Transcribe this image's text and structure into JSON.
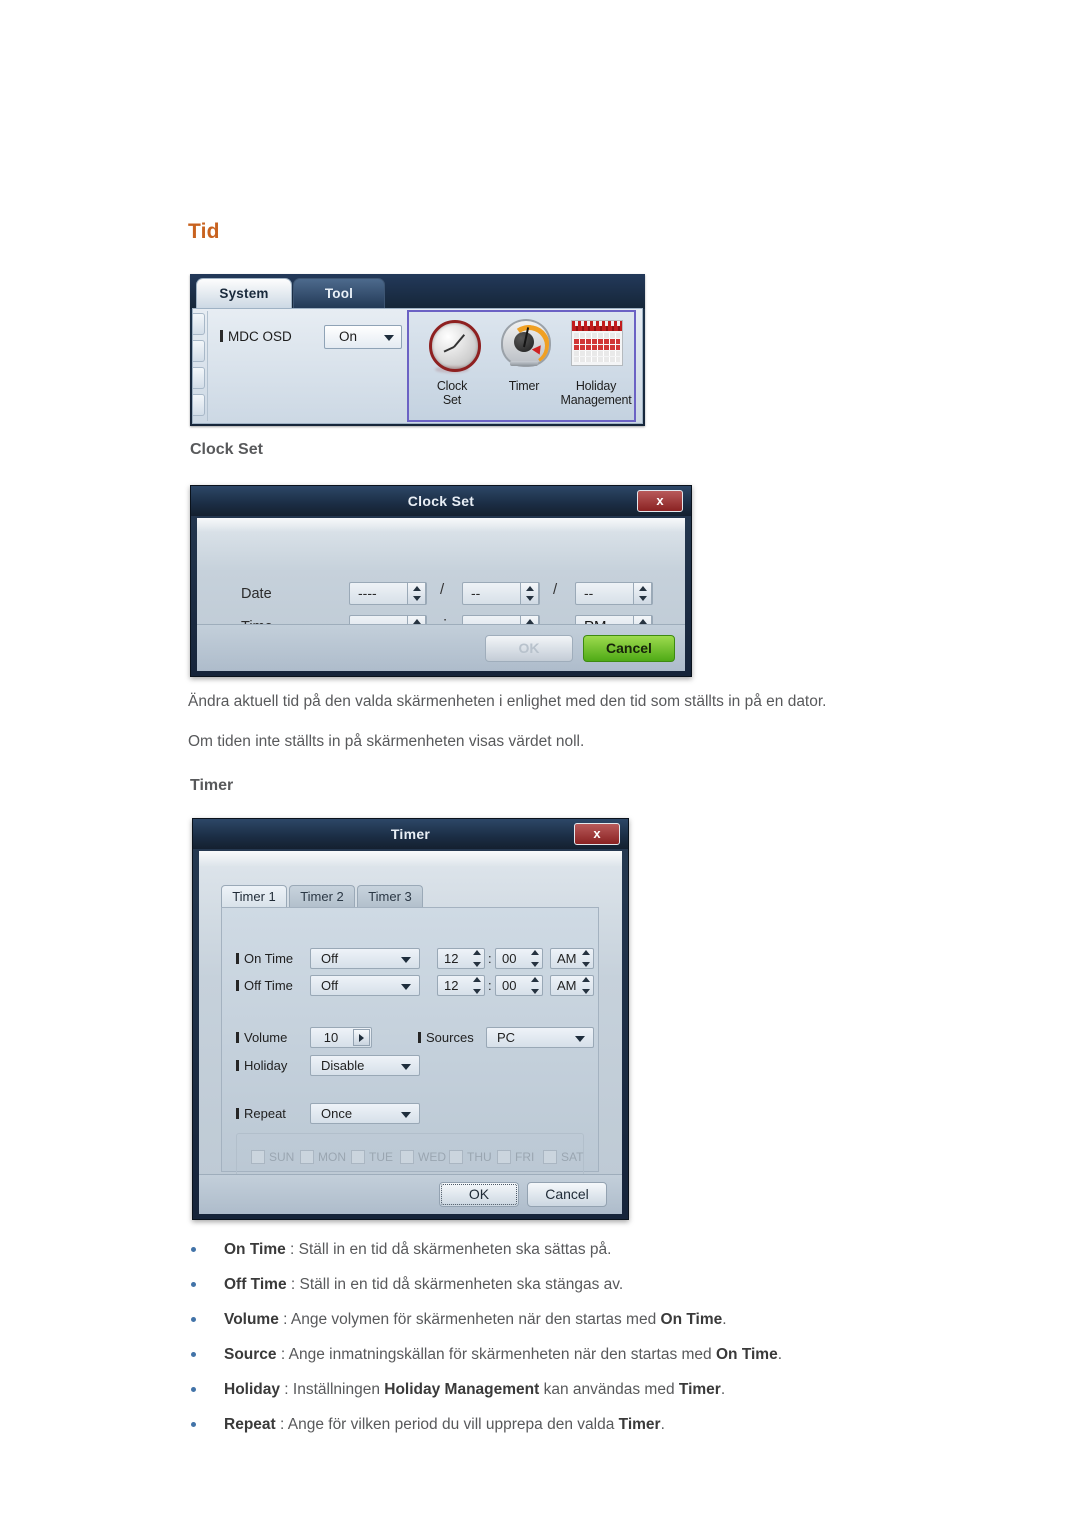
{
  "page": {
    "heading": "Tid",
    "subheadings": {
      "clock_set": "Clock Set",
      "timer": "Timer"
    },
    "paragraphs": {
      "p1": "Ändra aktuell tid på den valda skärmenheten i enlighet med den tid som ställts in på en dator.",
      "p2": "Om tiden inte ställts in på skärmenheten visas värdet noll."
    },
    "accent_color": "#c8621f",
    "text_color": "#58595b",
    "bullet_color": "#4273a8"
  },
  "mdc_panel": {
    "tabs": [
      {
        "label": "System",
        "active": true
      },
      {
        "label": "Tool",
        "active": false
      }
    ],
    "osd": {
      "label": "MDC OSD",
      "value": "On"
    },
    "icons": [
      {
        "name": "clock-set",
        "caption_line1": "Clock",
        "caption_line2": "Set"
      },
      {
        "name": "timer",
        "caption_line1": "Timer",
        "caption_line2": ""
      },
      {
        "name": "holiday-management",
        "caption_line1": "Holiday",
        "caption_line2": "Management"
      }
    ],
    "selection_color": "#6b62c4"
  },
  "clock_set_dialog": {
    "title": "Clock Set",
    "close_label": "x",
    "rows": [
      {
        "label": "Date",
        "fields": [
          {
            "value": "----"
          },
          {
            "value": "--"
          },
          {
            "value": "--"
          }
        ],
        "separators": [
          "/",
          "/"
        ]
      },
      {
        "label": "Time",
        "fields": [
          {
            "value": "--"
          },
          {
            "value": "--"
          },
          {
            "value": "PM"
          }
        ],
        "separators": [
          ":",
          ""
        ]
      }
    ],
    "buttons": {
      "ok": "OK",
      "cancel": "Cancel"
    },
    "ok_enabled": false,
    "cancel_color": "#6fc425"
  },
  "timer_dialog": {
    "title": "Timer",
    "close_label": "x",
    "tabs": [
      {
        "label": "Timer 1",
        "active": true
      },
      {
        "label": "Timer 2",
        "active": false
      },
      {
        "label": "Timer 3",
        "active": false
      }
    ],
    "fields": {
      "on_time": {
        "label": "On Time",
        "mode": "Off",
        "hour": "12",
        "minute": "00",
        "meridiem": "AM",
        "colon": ":"
      },
      "off_time": {
        "label": "Off Time",
        "mode": "Off",
        "hour": "12",
        "minute": "00",
        "meridiem": "AM",
        "colon": ":"
      },
      "volume": {
        "label": "Volume",
        "value": "10"
      },
      "sources": {
        "label": "Sources",
        "value": "PC"
      },
      "holiday": {
        "label": "Holiday",
        "value": "Disable"
      },
      "repeat": {
        "label": "Repeat",
        "value": "Once"
      }
    },
    "days": [
      {
        "label": "SUN",
        "checked": false
      },
      {
        "label": "MON",
        "checked": false
      },
      {
        "label": "TUE",
        "checked": false
      },
      {
        "label": "WED",
        "checked": false
      },
      {
        "label": "THU",
        "checked": false
      },
      {
        "label": "FRI",
        "checked": false
      },
      {
        "label": "SAT",
        "checked": false
      }
    ],
    "buttons": {
      "ok": "OK",
      "cancel": "Cancel"
    }
  },
  "bullets": [
    {
      "term": "On Time",
      "rest_1": " : Ställ in en tid då skärmenheten ska sättas på.",
      "term_2": "",
      "rest_2": "",
      "term_3": "",
      "rest_3": ""
    },
    {
      "term": "Off Time",
      "rest_1": " : Ställ in en tid då skärmenheten ska stängas av.",
      "term_2": "",
      "rest_2": "",
      "term_3": "",
      "rest_3": ""
    },
    {
      "term": "Volume",
      "rest_1": " : Ange volymen för skärmenheten när den startas med ",
      "term_2": "On Time",
      "rest_2": ".",
      "term_3": "",
      "rest_3": ""
    },
    {
      "term": "Source",
      "rest_1": " : Ange inmatningskällan för skärmenheten när den startas med ",
      "term_2": "On Time",
      "rest_2": ".",
      "term_3": "",
      "rest_3": ""
    },
    {
      "term": "Holiday",
      "rest_1": " : Inställningen ",
      "term_2": "Holiday Management",
      "rest_2": " kan användas med ",
      "term_3": "Timer",
      "rest_3": "."
    },
    {
      "term": "Repeat",
      "rest_1": " : Ange för vilken period du vill upprepa den valda ",
      "term_2": "Timer",
      "rest_2": ".",
      "term_3": "",
      "rest_3": ""
    }
  ]
}
